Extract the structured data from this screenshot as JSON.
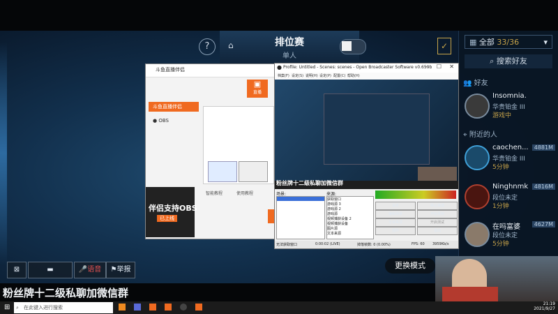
{
  "game": {
    "title": "排位赛",
    "subtitle": "单人",
    "close_glyph": "✕",
    "help_glyph": "?"
  },
  "friends_panel": {
    "filter_label": "全部",
    "filter_count": "33/36",
    "search_label": "搜索好友",
    "section_friends": "好友",
    "section_nearby": "附近的人",
    "friends": [
      {
        "name": "Insomnia.",
        "rank": "华贵铂金 III",
        "status": "游戏中",
        "number": ""
      },
      {
        "name": "caochen...",
        "rank": "华贵铂金 III",
        "status": "5分钟",
        "number": "4881M"
      },
      {
        "name": "Ninghnmk",
        "rank": "段位未定",
        "status": "1分钟",
        "number": "4816M"
      },
      {
        "name": "在吗富婆",
        "rank": "段位未定",
        "status": "5分钟",
        "number": "4627M"
      }
    ]
  },
  "douyu_window": {
    "title": "斗鱼直播伴侣",
    "menu_items": [
      "斗鱼直播伴侣",
      "OBS"
    ],
    "live_label": "直播",
    "ad_title": "伴侣支持OBS",
    "ad_sub": "已上线",
    "help_a": "智能教程",
    "help_b": "使用教程"
  },
  "obs_window": {
    "title": "Profile: Untitled - Scenes: scenes - Open Broadcaster Software v0.659b",
    "menu": [
      "档案(F)",
      "设定(S)",
      "说明(H)",
      "设定(P)",
      "配置(C)",
      "帮助(H)"
    ],
    "scenes_label": "场景:",
    "sources_label": "来源:",
    "sources": [
      "获取窗口",
      "游戏源 3",
      "游戏源 2",
      "游戏源",
      "视频捕获设备 2",
      "视频捕获设备",
      "图片源",
      "文本来源"
    ],
    "buttons": [
      "设定",
      "停止串流",
      "编辑场景",
      "开始录制",
      "全域来源",
      "开启测试",
      "插件",
      "退出"
    ],
    "status": [
      "无法获取窗口",
      "0:00:02 (LIVE)",
      "掉落帧数: 0 (0.00%)",
      "FPS: 60",
      "3959Kb/s"
    ],
    "overlay_text": "粉丝牌十二级私聊加微信群"
  },
  "bottom": {
    "swap_label": "更换模式",
    "mute_label": "语音",
    "report_label": "举报",
    "banner_text": "粉丝牌十二级私聊加微信群"
  },
  "taskbar": {
    "search_placeholder": "在此键入进行搜索",
    "time": "21:19",
    "date": "2021/9/27"
  }
}
